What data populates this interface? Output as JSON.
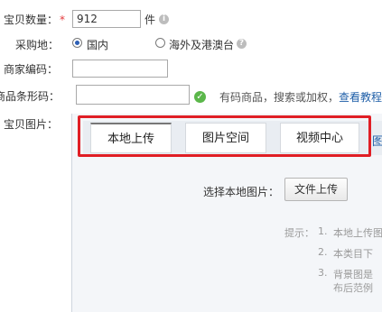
{
  "quantity": {
    "label": "宝贝数量：",
    "required_mark": "*",
    "value": "912",
    "unit": "件"
  },
  "origin": {
    "label": "采购地：",
    "options": [
      {
        "label": "国内",
        "selected": true
      },
      {
        "label": "海外及港澳台",
        "selected": false
      }
    ]
  },
  "merchant_code": {
    "label": "商家编码：",
    "value": ""
  },
  "barcode": {
    "label": "商品条形码：",
    "value": "",
    "hint": "有码商品，搜索或加权，",
    "link": "查看教程"
  },
  "images": {
    "label": "宝贝图片：",
    "tabs": [
      {
        "label": "本地上传",
        "active": true
      },
      {
        "label": "图片空间",
        "active": false
      },
      {
        "label": "视频中心",
        "active": false
      }
    ],
    "overflow_tab": "图",
    "select_label": "选择本地图片：",
    "upload_button": "文件上传",
    "tips_label": "提示：",
    "tips": [
      {
        "num": "1.",
        "text": "本地上传图"
      },
      {
        "num": "2.",
        "text": "本类目下"
      },
      {
        "num": "3.",
        "text": "背景图是"
      }
    ],
    "tip3_cont": "布后范例"
  },
  "colors": {
    "highlight_border": "#e01e25",
    "link": "#1f5fa8",
    "required": "#e4393c"
  }
}
